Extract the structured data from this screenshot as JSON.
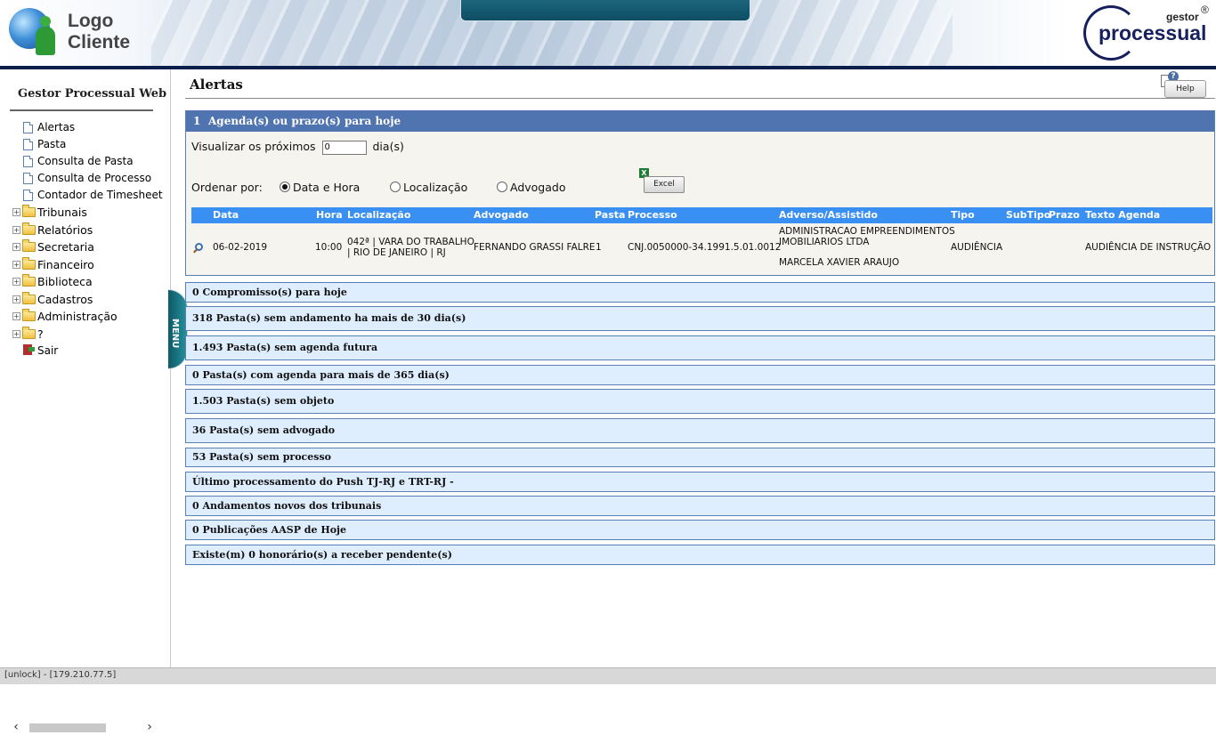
{
  "header": {
    "logo_line1": "Logo",
    "logo_line2": "Cliente",
    "brand_small": "gestor",
    "brand_reg": "®",
    "brand_main": "processual"
  },
  "sidebar": {
    "title": "Gestor Processual Web",
    "items": [
      {
        "label": "Alertas",
        "type": "doc"
      },
      {
        "label": "Pasta",
        "type": "doc"
      },
      {
        "label": "Consulta de Pasta",
        "type": "doc"
      },
      {
        "label": "Consulta de Processo",
        "type": "doc"
      },
      {
        "label": "Contador de Timesheet",
        "type": "doc"
      },
      {
        "label": "Tribunais",
        "type": "folder"
      },
      {
        "label": "Relatórios",
        "type": "folder"
      },
      {
        "label": "Secretaria",
        "type": "folder"
      },
      {
        "label": "Financeiro",
        "type": "folder"
      },
      {
        "label": "Biblioteca",
        "type": "folder"
      },
      {
        "label": "Cadastros",
        "type": "folder"
      },
      {
        "label": "Administração",
        "type": "folder"
      },
      {
        "label": "?",
        "type": "folder"
      },
      {
        "label": "Sair",
        "type": "exit"
      }
    ],
    "expander_symbol": "+"
  },
  "menu_tab": "MENU",
  "main": {
    "title": "Alertas",
    "help_label": "Help",
    "agenda": {
      "count": "1",
      "title": "Agenda(s) ou prazo(s) para hoje",
      "view_prefix": "Visualizar os próximos",
      "days_value": "0",
      "view_suffix": "dia(s)",
      "order_label": "Ordenar por:",
      "order_options": [
        {
          "label": "Data e Hora",
          "selected": true
        },
        {
          "label": "Localização",
          "selected": false
        },
        {
          "label": "Advogado",
          "selected": false
        }
      ],
      "excel_label": "Excel",
      "columns": [
        "Data",
        "Hora",
        "Localização",
        "Advogado",
        "Pasta",
        "Processo",
        "Adverso/Assistido",
        "Tipo",
        "SubTipo",
        "Prazo",
        "Texto Agenda"
      ],
      "rows": [
        {
          "data": "06-02-2019",
          "hora": "10:00",
          "localizacao_l1": "042ª | VARA DO TRABALHO",
          "localizacao_l2": "| RIO DE JANEIRO | RJ",
          "advogado": "FERNANDO GRASSI FALRE",
          "pasta": "1",
          "processo": "CNJ.0050000-34.1991.5.01.0012",
          "adverso_l1": "ADMINISTRACAO EMPREENDIMENTOS",
          "adverso_l2": "IMOBILIARIOS LTDA",
          "adverso_l3": "MARCELA XAVIER ARAUJO",
          "tipo": "AUDIÊNCIA",
          "subtipo": "",
          "prazo": "",
          "texto": "AUDIÊNCIA DE INSTRUÇÃO"
        }
      ]
    },
    "alerts": [
      "0   Compromisso(s) para hoje",
      "318 Pasta(s) sem andamento ha mais de 30 dia(s)",
      "1.493 Pasta(s) sem agenda futura",
      "0 Pasta(s) com agenda para mais de 365 dia(s)",
      "1.503 Pasta(s) sem objeto",
      "36 Pasta(s) sem advogado",
      "53   Pasta(s) sem processo",
      "Último processamento do Push TJ-RJ e TRT-RJ -",
      "0 Andamentos novos dos tribunais",
      "0  Publicações AASP de Hoje",
      "Existe(m) 0 honorário(s) a receber pendente(s)"
    ]
  },
  "status_bar": "[unlock] - [179.210.77.5]",
  "colors": {
    "header_bar": "#0c1f4a",
    "panel_header": "#4f74b0",
    "grid_header": "#3a8ff2",
    "alert_bg": "#dfeefe",
    "alert_border": "#5a7fb5",
    "menu_tab": "#27909e"
  }
}
